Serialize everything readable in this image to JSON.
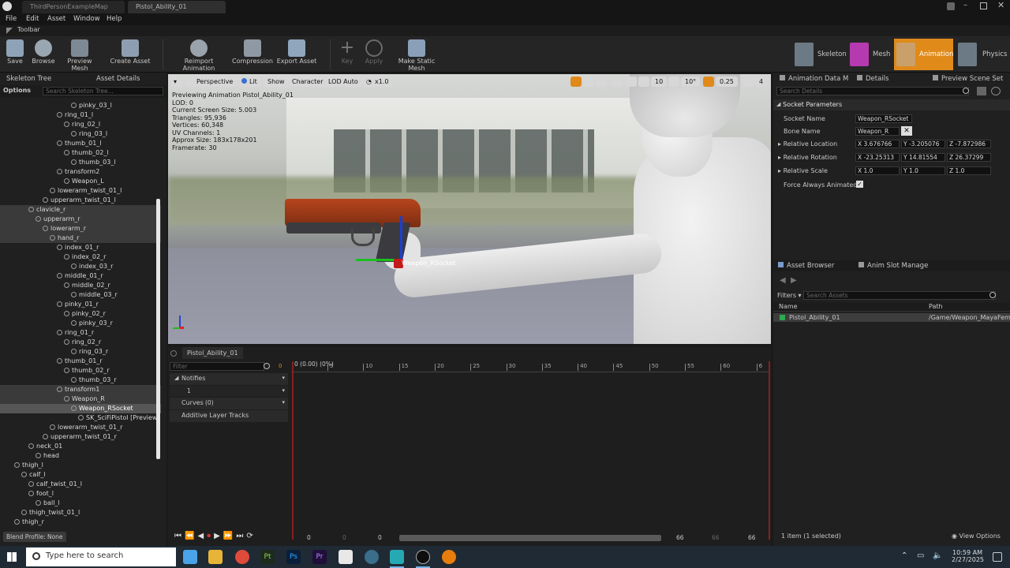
{
  "title_bar": {
    "tabs": [
      "ThirdPersonExampleMap",
      "Pistol_Ability_01"
    ]
  },
  "menu": [
    "File",
    "Edit",
    "Asset",
    "Window",
    "Help"
  ],
  "toolbar_label": "Toolbar",
  "toolbar": {
    "buttons": [
      "Save",
      "Browse",
      "Preview Mesh",
      "Create Asset",
      "Reimport Animation",
      "Compression",
      "Export Asset",
      "Key",
      "Apply",
      "Make Static Mesh"
    ],
    "modes": [
      "Skeleton",
      "Mesh",
      "Animation",
      "Physics"
    ]
  },
  "left_panel": {
    "tabs": [
      "Skeleton Tree",
      "Asset Details"
    ],
    "options_label": "Options",
    "search_placeholder": "Search Skeleton Tree...",
    "bones": [
      {
        "label": "pinky_03_l",
        "indent": 10
      },
      {
        "label": "ring_01_l",
        "indent": 8
      },
      {
        "label": "ring_02_l",
        "indent": 9
      },
      {
        "label": "ring_03_l",
        "indent": 10
      },
      {
        "label": "thumb_01_l",
        "indent": 8
      },
      {
        "label": "thumb_02_l",
        "indent": 9
      },
      {
        "label": "thumb_03_l",
        "indent": 10
      },
      {
        "label": "transform2",
        "indent": 8
      },
      {
        "label": "Weapon_L",
        "indent": 9
      },
      {
        "label": "lowerarm_twist_01_l",
        "indent": 7
      },
      {
        "label": "upperarm_twist_01_l",
        "indent": 6
      },
      {
        "label": "clavicle_r",
        "indent": 4
      },
      {
        "label": "upperarm_r",
        "indent": 5
      },
      {
        "label": "lowerarm_r",
        "indent": 6
      },
      {
        "label": "hand_r",
        "indent": 7
      },
      {
        "label": "index_01_r",
        "indent": 8
      },
      {
        "label": "index_02_r",
        "indent": 9
      },
      {
        "label": "index_03_r",
        "indent": 10
      },
      {
        "label": "middle_01_r",
        "indent": 8
      },
      {
        "label": "middle_02_r",
        "indent": 9
      },
      {
        "label": "middle_03_r",
        "indent": 10
      },
      {
        "label": "pinky_01_r",
        "indent": 8
      },
      {
        "label": "pinky_02_r",
        "indent": 9
      },
      {
        "label": "pinky_03_r",
        "indent": 10
      },
      {
        "label": "ring_01_r",
        "indent": 8
      },
      {
        "label": "ring_02_r",
        "indent": 9
      },
      {
        "label": "ring_03_r",
        "indent": 10
      },
      {
        "label": "thumb_01_r",
        "indent": 8
      },
      {
        "label": "thumb_02_r",
        "indent": 9
      },
      {
        "label": "thumb_03_r",
        "indent": 10
      },
      {
        "label": "transform1",
        "indent": 8
      },
      {
        "label": "Weapon_R",
        "indent": 9
      },
      {
        "label": "Weapon_RSocket",
        "indent": 10
      },
      {
        "label": "SK_SciFiPistol [Preview",
        "indent": 11
      },
      {
        "label": "lowerarm_twist_01_r",
        "indent": 7
      },
      {
        "label": "upperarm_twist_01_r",
        "indent": 6
      },
      {
        "label": "neck_01",
        "indent": 4
      },
      {
        "label": "head",
        "indent": 5
      },
      {
        "label": "thigh_l",
        "indent": 2
      },
      {
        "label": "calf_l",
        "indent": 3
      },
      {
        "label": "calf_twist_01_l",
        "indent": 4
      },
      {
        "label": "foot_l",
        "indent": 4
      },
      {
        "label": "ball_l",
        "indent": 5
      },
      {
        "label": "thigh_twist_01_l",
        "indent": 3
      },
      {
        "label": "thigh_r",
        "indent": 2
      }
    ],
    "blend_profile": "Blend Profile: None"
  },
  "viewport": {
    "buttons": [
      "Perspective",
      "Lit",
      "Show",
      "Character",
      "LOD Auto",
      "x1.0"
    ],
    "right_controls": [
      "10",
      "10°",
      "0.25",
      "4"
    ],
    "stats": [
      "Previewing Animation Pistol_Ability_01",
      "LOD: 0",
      "Current Screen Size: 5.003",
      "Triangles: 95,936",
      "Vertices: 60,348",
      "UV Channels: 1",
      "Approx Size: 183x178x201",
      "Framerate: 30"
    ],
    "socket_label": "Weapon_RSocket"
  },
  "timeline": {
    "tab": "Pistol_Ability_01",
    "filter_placeholder": "Filter",
    "notifies": "Notifies",
    "track_number": "1",
    "curves": "Curves",
    "curves_count": "(0)",
    "additive": "Additive Layer Tracks",
    "start_label": "0 (0.00) (0%)",
    "ticks": [
      "5",
      "10",
      "15",
      "20",
      "25",
      "30",
      "35",
      "40",
      "45",
      "50",
      "55",
      "60",
      "6"
    ],
    "frame_start": "0",
    "bottom_values": [
      "0",
      "0",
      "0",
      "66",
      "66",
      "66"
    ]
  },
  "right_panel": {
    "tabs": [
      "Animation Data M",
      "Details",
      "Preview Scene Set"
    ],
    "search_placeholder": "Search Details",
    "section": "Socket Parameters",
    "socket_name_label": "Socket Name",
    "socket_name": "Weapon_RSocket",
    "bone_name_label": "Bone Name",
    "bone_name": "Weapon_R",
    "location_label": "Relative Location",
    "location": [
      "3.676766",
      "-3.205076",
      "-7.872986"
    ],
    "rotation_label": "Relative Rotation",
    "rotation": [
      "-23.25313",
      "14.81554",
      "26.37299"
    ],
    "scale_label": "Relative Scale",
    "scale": [
      "1.0",
      "1.0",
      "1.0"
    ],
    "force_label": "Force Always Animated",
    "asset_tabs": [
      "Asset Browser",
      "Anim Slot Manage"
    ],
    "filters_label": "Filters",
    "search_assets": "Search Assets",
    "col_name": "Name",
    "col_path": "Path",
    "asset_name": "Pistol_Ability_01",
    "asset_path": "/Game/Weapon_MayaFem",
    "status": "1 item (1 selected)",
    "view_options": "View Options"
  },
  "taskbar": {
    "search_placeholder": "Type here to search",
    "time": "10:59 AM",
    "date": "2/27/2025"
  },
  "colors": {
    "accent_orange": "#e08a1a",
    "selected": "#565656"
  }
}
